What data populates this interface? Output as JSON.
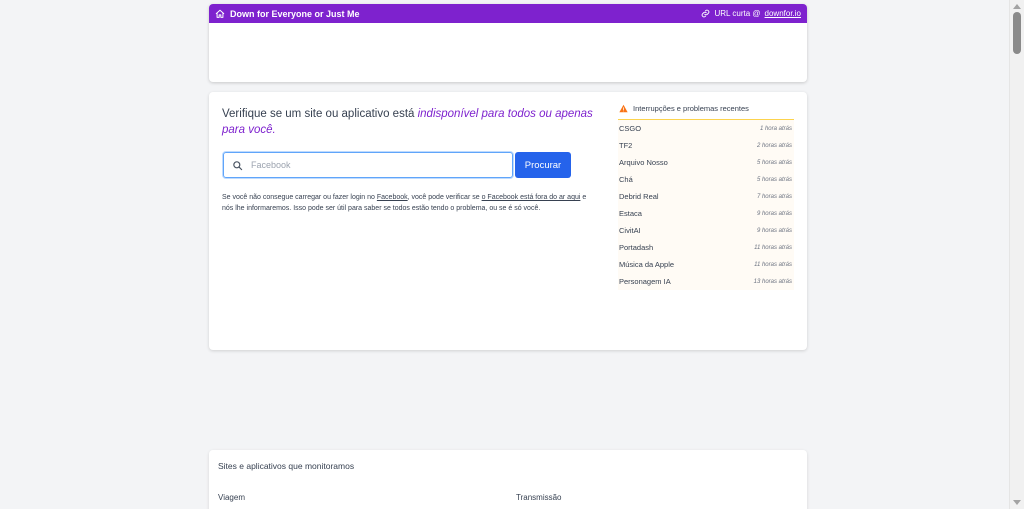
{
  "header": {
    "title": "Down for Everyone or Just Me",
    "short_url_label": "URL curta @",
    "short_url_domain": "downfor.io",
    "icons": {
      "home": "home-icon",
      "link": "link-icon"
    },
    "brand_color": "#7e22ce"
  },
  "main": {
    "headline_plain": "Verifique se um site ou aplicativo está ",
    "headline_em": "indisponível para todos ou apenas para você.",
    "search": {
      "placeholder": "Facebook",
      "value": "",
      "button_label": "Procurar"
    },
    "desc": {
      "p1": "Se você não consegue carregar ou fazer login no ",
      "link1": "Facebook",
      "p2": ", você pode verificar se ",
      "link2": "o Facebook está fora do ar aqui",
      "p3": " e nós lhe informaremos. Isso pode ser útil para saber se todos estão tendo o problema, ou se é só você."
    }
  },
  "outages": {
    "title": "Interrupções e problemas recentes",
    "items": [
      {
        "name": "CSGO",
        "time": "1 hora atrás"
      },
      {
        "name": "TF2",
        "time": "2 horas atrás"
      },
      {
        "name": "Arquivo Nosso",
        "time": "5 horas atrás"
      },
      {
        "name": "Chá",
        "time": "5 horas atrás"
      },
      {
        "name": "Debrid Real",
        "time": "7 horas atrás"
      },
      {
        "name": "Estaca",
        "time": "9 horas atrás"
      },
      {
        "name": "CivitAI",
        "time": "9 horas atrás"
      },
      {
        "name": "Portadash",
        "time": "11 horas atrás"
      },
      {
        "name": "Música da Apple",
        "time": "11 horas atrás"
      },
      {
        "name": "Personagem IA",
        "time": "13 horas atrás"
      }
    ]
  },
  "monitored": {
    "title": "Sites e aplicativos que monitoramos",
    "cat_left": "Viagem",
    "cat_right": "Transmissão"
  }
}
